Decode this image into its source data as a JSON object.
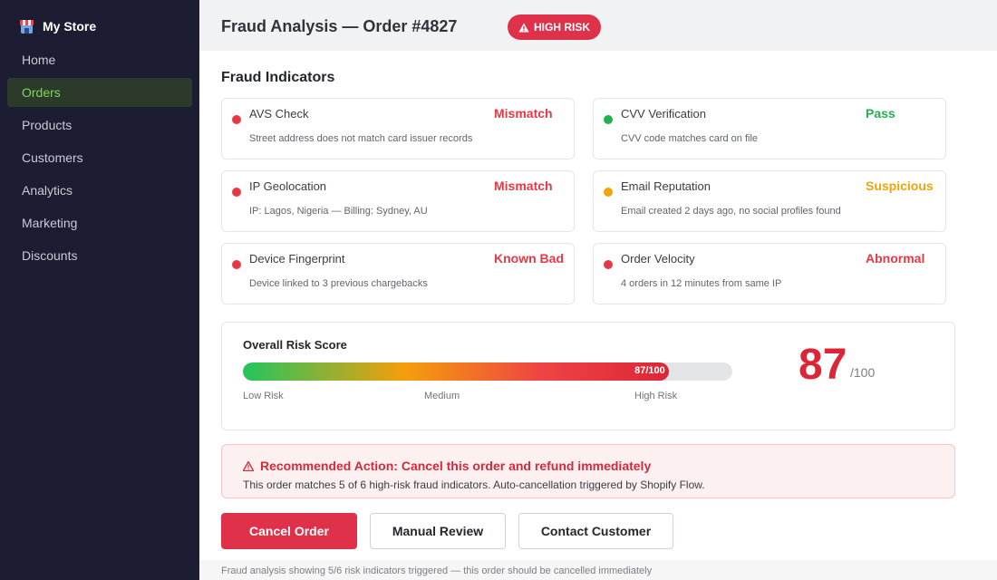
{
  "app": {
    "brand": "My Store"
  },
  "sidebar": {
    "items": [
      {
        "label": "Home",
        "active": false
      },
      {
        "label": "Orders",
        "active": true
      },
      {
        "label": "Products",
        "active": false
      },
      {
        "label": "Customers",
        "active": false
      },
      {
        "label": "Analytics",
        "active": false
      },
      {
        "label": "Marketing",
        "active": false
      },
      {
        "label": "Discounts",
        "active": false
      }
    ]
  },
  "header": {
    "title": "Fraud Analysis — Order #4827",
    "badge": "HIGH RISK"
  },
  "indicators": {
    "title": "Fraud Indicators",
    "items": [
      {
        "name": "AVS Check",
        "status": "Mismatch",
        "description": "Street address does not match card issuer records",
        "color": "#e53945"
      },
      {
        "name": "CVV Verification",
        "status": "Pass",
        "description": "CVV code matches card on file",
        "color": "#22b24c"
      },
      {
        "name": "IP Geolocation",
        "status": "Mismatch",
        "description": "IP: Lagos, Nigeria — Billing: Sydney, AU",
        "color": "#e53945"
      },
      {
        "name": "Email Reputation",
        "status": "Suspicious",
        "description": "Email created 2 days ago, no social profiles found",
        "color": "#f0a30a"
      },
      {
        "name": "Device Fingerprint",
        "status": "Known Bad",
        "description": "Device linked to 3 previous chargebacks",
        "color": "#e53945"
      },
      {
        "name": "Order Velocity",
        "status": "Abnormal",
        "description": "4 orders in 12 minutes from same IP",
        "color": "#e53945"
      }
    ]
  },
  "risk": {
    "title": "Overall Risk Score",
    "score": 87,
    "max": 100,
    "bar_label": "87/100",
    "score_text": "87",
    "max_text": "/100",
    "captions": {
      "low": "Low Risk",
      "medium": "Medium",
      "high": "High Risk"
    }
  },
  "alert": {
    "title": "Recommended Action: Cancel this order and refund immediately",
    "text": "This order matches 5 of 6 high-risk fraud indicators. Auto-cancellation triggered by Shopify Flow."
  },
  "actions": {
    "cancel": "Cancel Order",
    "review": "Manual Review",
    "contact": "Contact Customer"
  },
  "footer": {
    "text": "Fraud analysis showing 5/6 risk indicators triggered — this order should be cancelled immediately"
  },
  "colors": {
    "danger": "#e0314b",
    "sidebar_bg": "#1c1d33",
    "active_nav": "#7ed957"
  }
}
